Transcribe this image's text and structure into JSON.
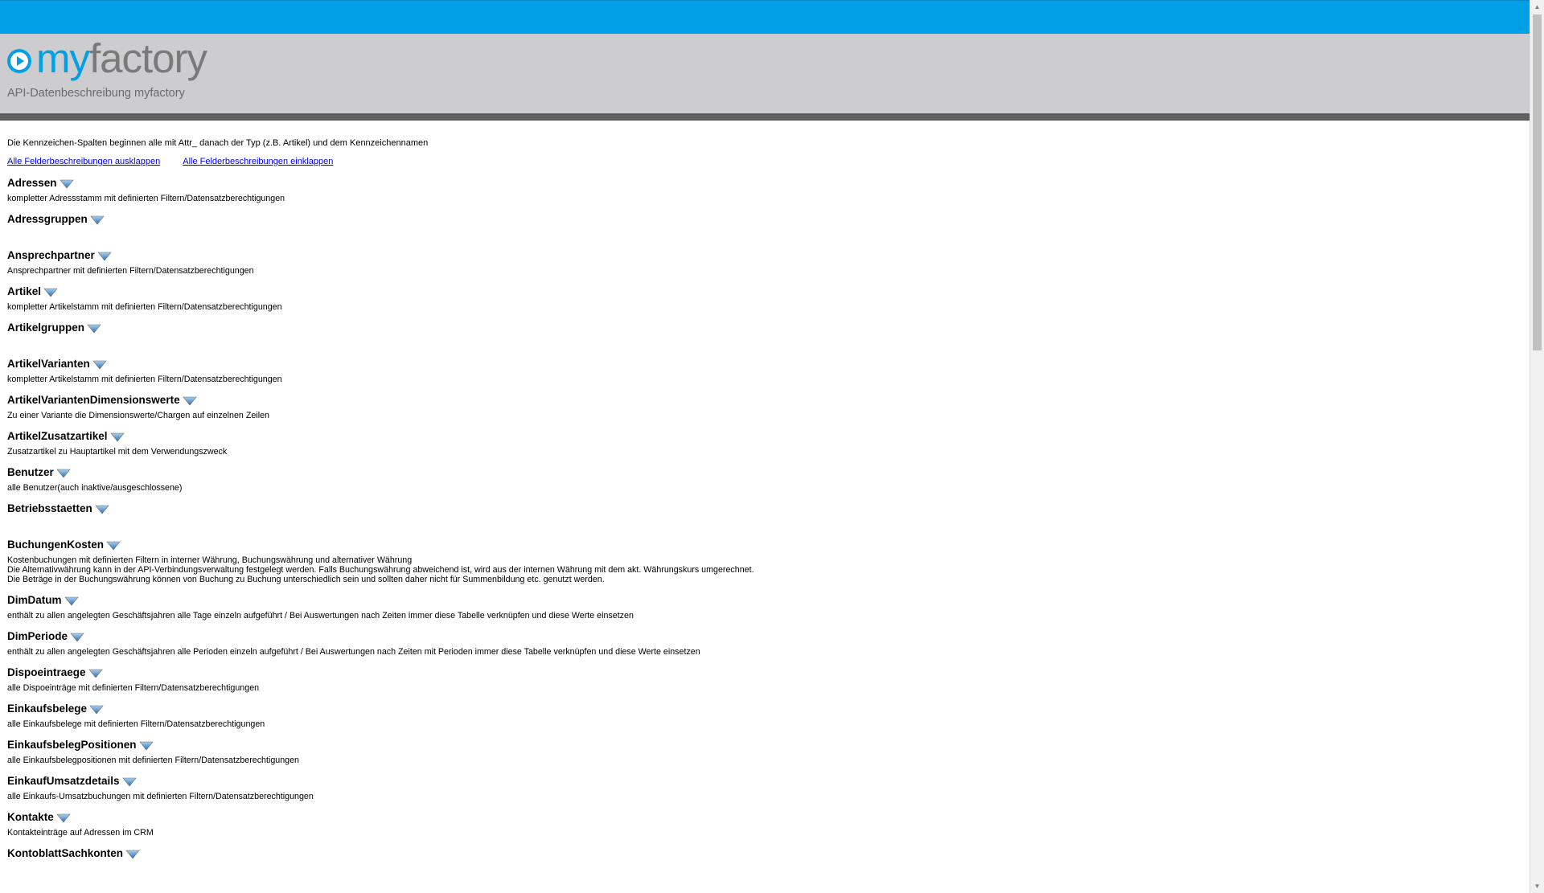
{
  "header": {
    "logo_my": "my",
    "logo_factory": "factory",
    "subtitle": "API-Datenbeschreibung myfactory"
  },
  "intro": "Die Kennzeichen-Spalten beginnen alle mit Attr_ danach der Typ (z.B. Artikel) und dem Kennzeichennamen",
  "links": {
    "expand_all": "Alle Felderbeschreibungen ausklappen",
    "collapse_all": "Alle Felderbeschreibungen einklappen"
  },
  "colors": {
    "accent": "#00a0e6",
    "header_bg": "#cdcccf",
    "divider": "#5f5f5f",
    "toggle": "#3d82c5"
  },
  "entries": [
    {
      "title": "Adressen",
      "desc": "kompletter Adressstamm mit definierten Filtern/Datensatzberechtigungen"
    },
    {
      "title": "Adressgruppen",
      "desc": ""
    },
    {
      "title": "Ansprechpartner",
      "desc": "Ansprechpartner mit definierten Filtern/Datensatzberechtigungen"
    },
    {
      "title": "Artikel",
      "desc": "kompletter Artikelstamm mit definierten Filtern/Datensatzberechtigungen"
    },
    {
      "title": "Artikelgruppen",
      "desc": ""
    },
    {
      "title": "ArtikelVarianten",
      "desc": "kompletter Artikelstamm mit definierten Filtern/Datensatzberechtigungen"
    },
    {
      "title": "ArtikelVariantenDimensionswerte",
      "desc": "Zu einer Variante die Dimensionswerte/Chargen auf einzelnen Zeilen"
    },
    {
      "title": "ArtikelZusatzartikel",
      "desc": "Zusatzartikel zu Hauptartikel mit dem Verwendungszweck"
    },
    {
      "title": "Benutzer",
      "desc": "alle Benutzer(auch inaktive/ausgeschlossene)"
    },
    {
      "title": "Betriebsstaetten",
      "desc": ""
    },
    {
      "title": "BuchungenKosten",
      "desc": "Kostenbuchungen mit definierten Filtern in interner Währung, Buchungswährung und alternativer Währung\nDie Alternativwährung kann in der API-Verbindungsverwaltung festgelegt werden. Falls Buchungswährung abweichend ist, wird aus der internen Währung mit dem akt. Währungskurs umgerechnet.\nDie Beträge in der Buchungswährung können von Buchung zu Buchung unterschiedlich sein und sollten daher nicht für Summenbildung etc. genutzt werden."
    },
    {
      "title": "DimDatum",
      "desc": "enthält zu allen angelegten Geschäftsjahren alle Tage einzeln aufgeführt / Bei Auswertungen nach Zeiten immer diese Tabelle verknüpfen und diese Werte einsetzen"
    },
    {
      "title": "DimPeriode",
      "desc": "enthält zu allen angelegten Geschäftsjahren alle Perioden einzeln aufgeführt / Bei Auswertungen nach Zeiten mit Perioden immer diese Tabelle verknüpfen und diese Werte einsetzen"
    },
    {
      "title": "Dispoeintraege",
      "desc": "alle Dispoeinträge mit definierten Filtern/Datensatzberechtigungen"
    },
    {
      "title": "Einkaufsbelege",
      "desc": "alle Einkaufsbelege mit definierten Filtern/Datensatzberechtigungen"
    },
    {
      "title": "EinkaufsbelegPositionen",
      "desc": "alle Einkaufsbelegpositionen mit definierten Filtern/Datensatzberechtigungen"
    },
    {
      "title": "EinkaufUmsatzdetails",
      "desc": "alle Einkaufs-Umsatzbuchungen mit definierten Filtern/Datensatzberechtigungen"
    },
    {
      "title": "Kontakte",
      "desc": "Kontakteinträge auf Adressen im CRM"
    },
    {
      "title": "KontoblattSachkonten",
      "desc": ""
    }
  ]
}
